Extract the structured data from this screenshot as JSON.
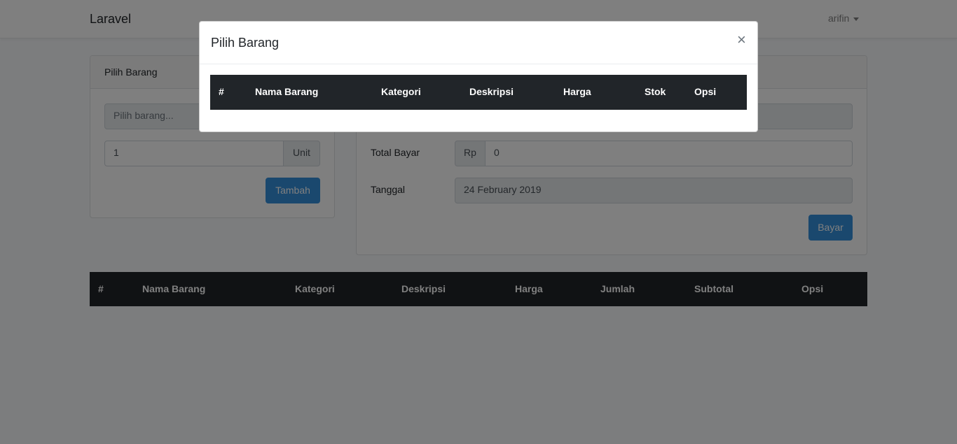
{
  "navbar": {
    "brand": "Laravel",
    "user": "arifin"
  },
  "left_card": {
    "header": "Pilih Barang",
    "item_placeholder": "Pilih barang...",
    "qty_value": "1",
    "unit_label": "Unit",
    "add_button": "Tambah"
  },
  "right_card": {
    "total_label": "Total Bayar",
    "currency": "Rp",
    "total_value": "0",
    "date_label": "Tanggal",
    "date_value": "24 February 2019",
    "pay_button": "Bayar"
  },
  "cart_table": {
    "columns": [
      "#",
      "Nama Barang",
      "Kategori",
      "Deskripsi",
      "Harga",
      "Jumlah",
      "Subtotal",
      "Opsi"
    ],
    "rows": []
  },
  "modal": {
    "title": "Pilih Barang",
    "close": "×",
    "columns": [
      "#",
      "Nama Barang",
      "Kategori",
      "Deskripsi",
      "Harga",
      "Stok",
      "Opsi"
    ],
    "rows": []
  }
}
